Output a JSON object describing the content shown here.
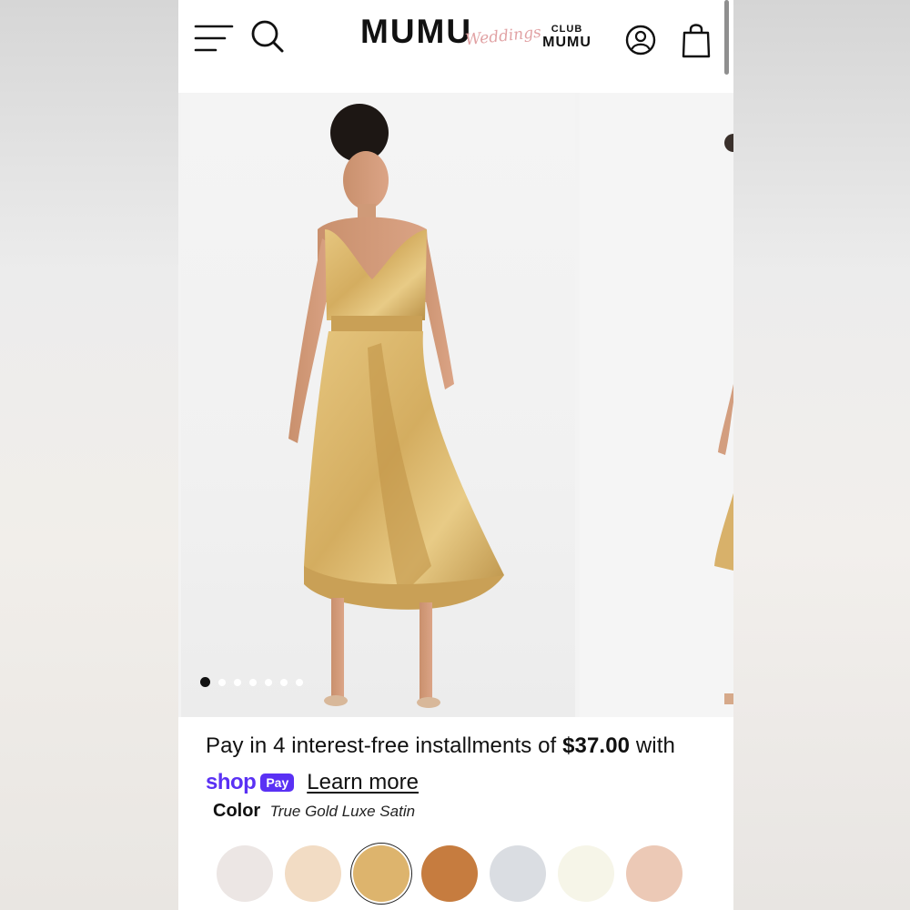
{
  "header": {
    "logo_main": "MUMU",
    "logo_script": "Weddings",
    "club_top": "CLUB",
    "club_bottom": "MUMU",
    "icons": [
      "menu-icon",
      "search-icon",
      "account-icon",
      "shopping-bag-icon"
    ]
  },
  "gallery": {
    "image_count": 7,
    "active_index": 0
  },
  "installments": {
    "prefix": "Pay in 4 interest-free installments of ",
    "amount": "$37.00",
    "suffix": " with"
  },
  "shop_pay": {
    "shop_word": "shop",
    "pay_badge": "Pay",
    "learn_more": "Learn more",
    "brand_color": "#5a31f4"
  },
  "color": {
    "label": "Color",
    "value": "True Gold Luxe Satin"
  },
  "swatches": [
    {
      "color": "#ece6e4",
      "selected": false
    },
    {
      "color": "#f2dcc4",
      "selected": false
    },
    {
      "color": "#ddb46d",
      "selected": true
    },
    {
      "color": "#c67c3f",
      "selected": false
    },
    {
      "color": "#dadde2",
      "selected": false
    },
    {
      "color": "#f6f5e8",
      "selected": false
    },
    {
      "color": "#ecc9b6",
      "selected": false
    }
  ]
}
